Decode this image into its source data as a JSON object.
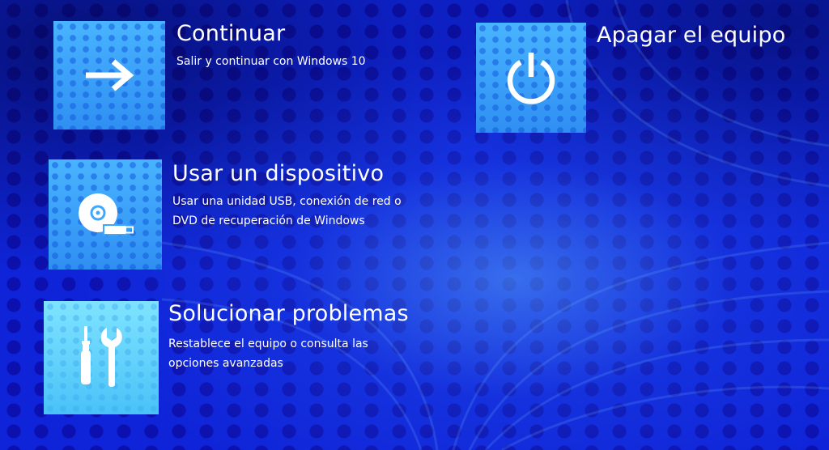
{
  "options": {
    "continue": {
      "title": "Continuar",
      "description": "Salir y continuar con Windows 10",
      "icon": "arrow-right-icon"
    },
    "use_device": {
      "title": "Usar un dispositivo",
      "description_line1": "Usar una unidad USB, conexión de red o",
      "description_line2": "DVD de recuperación de Windows",
      "icon": "disc-usb-icon"
    },
    "troubleshoot": {
      "title": "Solucionar problemas",
      "description_line1": "Restablece el equipo o consulta las",
      "description_line2": "opciones avanzadas",
      "icon": "tools-icon"
    },
    "shutdown": {
      "title": "Apagar el equipo",
      "icon": "power-icon"
    }
  },
  "colors": {
    "background": "#0f24d8",
    "tile": "#3ea8ff",
    "tile_light": "#6ad6ff",
    "text": "#ffffff"
  }
}
